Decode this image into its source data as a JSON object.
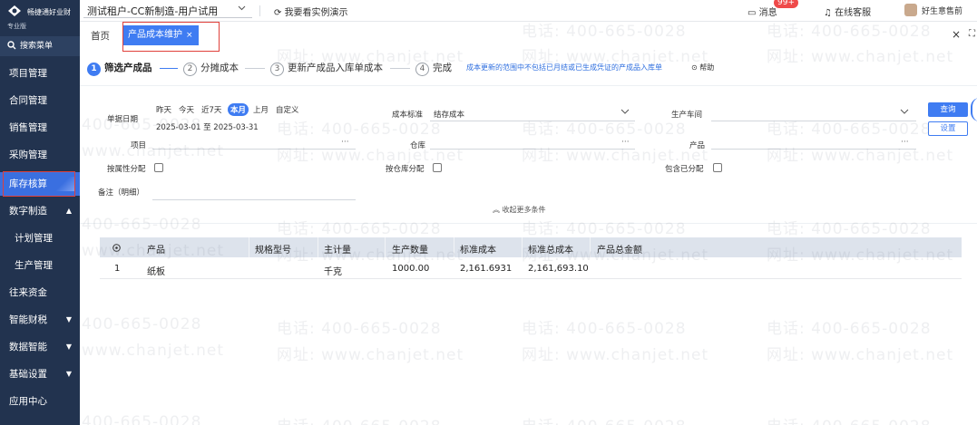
{
  "app": {
    "brand": "畅捷通好业财",
    "edition": "专业版",
    "tenant": "测试租户-CC新制造-用户试用",
    "demo_link": "我要看实例演示",
    "messages_label": "消息",
    "messages_badge": "99+",
    "service_label": "在线客服",
    "user_name": "好生意售前"
  },
  "sidebar": {
    "search_label": "搜索菜单",
    "items": [
      {
        "label": "项目管理"
      },
      {
        "label": "合同管理"
      },
      {
        "label": "销售管理"
      },
      {
        "label": "采购管理"
      },
      {
        "label": "库存核算"
      },
      {
        "label": "数字制造",
        "caret": "▲"
      },
      {
        "label": "计划管理"
      },
      {
        "label": "生产管理"
      },
      {
        "label": "往来资金"
      },
      {
        "label": "智能财税",
        "caret": "▼"
      },
      {
        "label": "数据智能",
        "caret": "▼"
      },
      {
        "label": "基础设置",
        "caret": "▼"
      },
      {
        "label": "应用中心"
      }
    ]
  },
  "tabs": {
    "home": "首页",
    "active": "产品成本维护",
    "active_close": "×",
    "close_all": "×",
    "expand": "⛶"
  },
  "steps": {
    "items": [
      {
        "num": "1",
        "label": "筛选产成品"
      },
      {
        "num": "2",
        "label": "分摊成本"
      },
      {
        "num": "3",
        "label": "更新产成品入库单成本"
      },
      {
        "num": "4",
        "label": "完成"
      }
    ],
    "note": "成本更新的范围中不包括已月结或已生成凭证的产成品入库单",
    "help": "帮助"
  },
  "form": {
    "date_label": "单据日期",
    "date_chips": [
      "昨天",
      "今天",
      "近7天",
      "本月",
      "上月",
      "自定义"
    ],
    "date_range": "2025-03-01 至 2025-03-31",
    "cost_std_label": "成本标准",
    "cost_std_value": "结存成本",
    "workshop_label": "生产车间",
    "project_label": "项目",
    "warehouse_label": "仓库",
    "product_label": "产品",
    "by_attr_label": "按属性分配",
    "by_wh_label": "按仓库分配",
    "include_label": "包含已分配",
    "remark_label": "备注（明细）",
    "query_btn": "查询",
    "settings_btn": "设置",
    "collapse_label": "收起更多条件",
    "ellipsis": "···"
  },
  "table": {
    "headers": [
      "产品",
      "规格型号",
      "主计量",
      "生产数量",
      "标准成本",
      "标准总成本",
      "产品总金额"
    ],
    "rows": [
      {
        "idx": "1",
        "product": "纸板",
        "spec": "",
        "unit": "千克",
        "qty": "1000.00",
        "std_cost": "2,161.6931",
        "std_total": "2,161,693.10",
        "amount": ""
      }
    ]
  },
  "watermark": {
    "phone": "电话: 400-665-0028",
    "site": "网址: www.chanjet.net",
    "phone_short": "400-665-0028",
    "site_short": "www.chanjet.net"
  },
  "colors": {
    "sidebar_bg": "#22334f",
    "accent": "#3f7cf2",
    "highlight_box": "#e0403a",
    "badge": "#ef4a4a"
  }
}
